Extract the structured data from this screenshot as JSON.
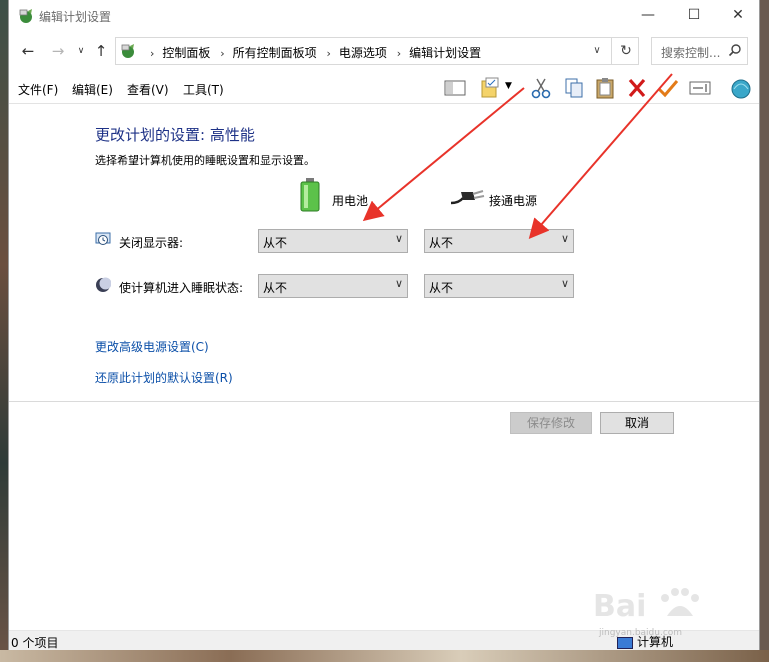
{
  "window": {
    "title": "编辑计划设置",
    "controls": {
      "minimize": "—",
      "maximize": "☐",
      "close": "✕"
    }
  },
  "address": {
    "breadcrumbs": [
      "控制面板",
      "所有控制面板项",
      "电源选项",
      "编辑计划设置"
    ],
    "search_placeholder": "搜索控制..."
  },
  "menu": {
    "file": "文件(F)",
    "edit": "编辑(E)",
    "view": "查看(V)",
    "tools": "工具(T)"
  },
  "main": {
    "heading": "更改计划的设置: 高性能",
    "subtext": "选择希望计算机使用的睡眠设置和显示设置。",
    "columns": {
      "battery": "用电池",
      "plugged": "接通电源"
    },
    "rows": [
      {
        "label": "关闭显示器:",
        "battery_value": "从不",
        "plugged_value": "从不"
      },
      {
        "label": "使计算机进入睡眠状态:",
        "battery_value": "从不",
        "plugged_value": "从不"
      }
    ],
    "links": {
      "advanced": "更改高级电源设置(C)",
      "restore": "还原此计划的默认设置(R)"
    },
    "buttons": {
      "save": "保存修改",
      "cancel": "取消"
    }
  },
  "status": {
    "items": "0 个项目",
    "location": "计算机"
  },
  "watermark": {
    "text": "Baidu经验",
    "url": "jingyan.baidu.com"
  },
  "colors": {
    "heading": "#1e3287",
    "link": "#0b4fa8",
    "annotation_arrow": "#e8332a"
  }
}
